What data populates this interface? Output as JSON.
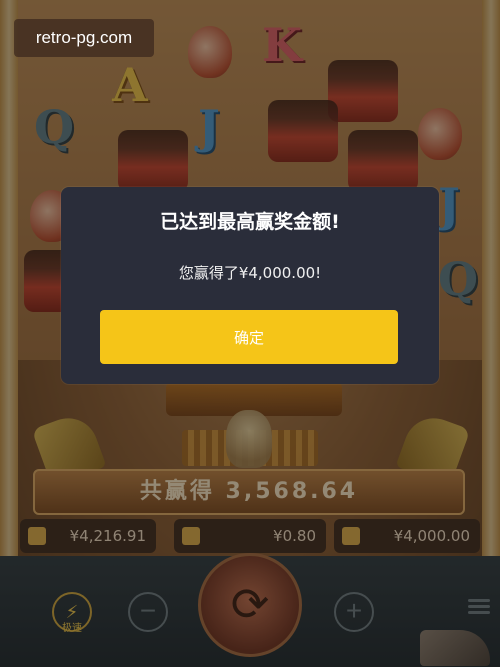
{
  "site_label": "retro-pg.com",
  "dialog": {
    "title": "已达到最高赢奖金额!",
    "message": "您赢得了¥4,000.00!",
    "ok_label": "确定"
  },
  "symbols": [
    "A",
    "Q",
    "K",
    "J",
    "J",
    "Q"
  ],
  "win_banner": {
    "label": "共赢得 3,568.64"
  },
  "stats": {
    "balance": "¥4,216.91",
    "bet": "¥0.80",
    "win": "¥4,000.00"
  },
  "controls": {
    "turbo_label": "极速",
    "turbo_glyph": "⚡",
    "minus_glyph": "−",
    "plus_glyph": "+",
    "spin_glyph": "⟳"
  },
  "colors": {
    "dialog_bg": "#2a2d3a",
    "ok_button": "#f5c518"
  }
}
